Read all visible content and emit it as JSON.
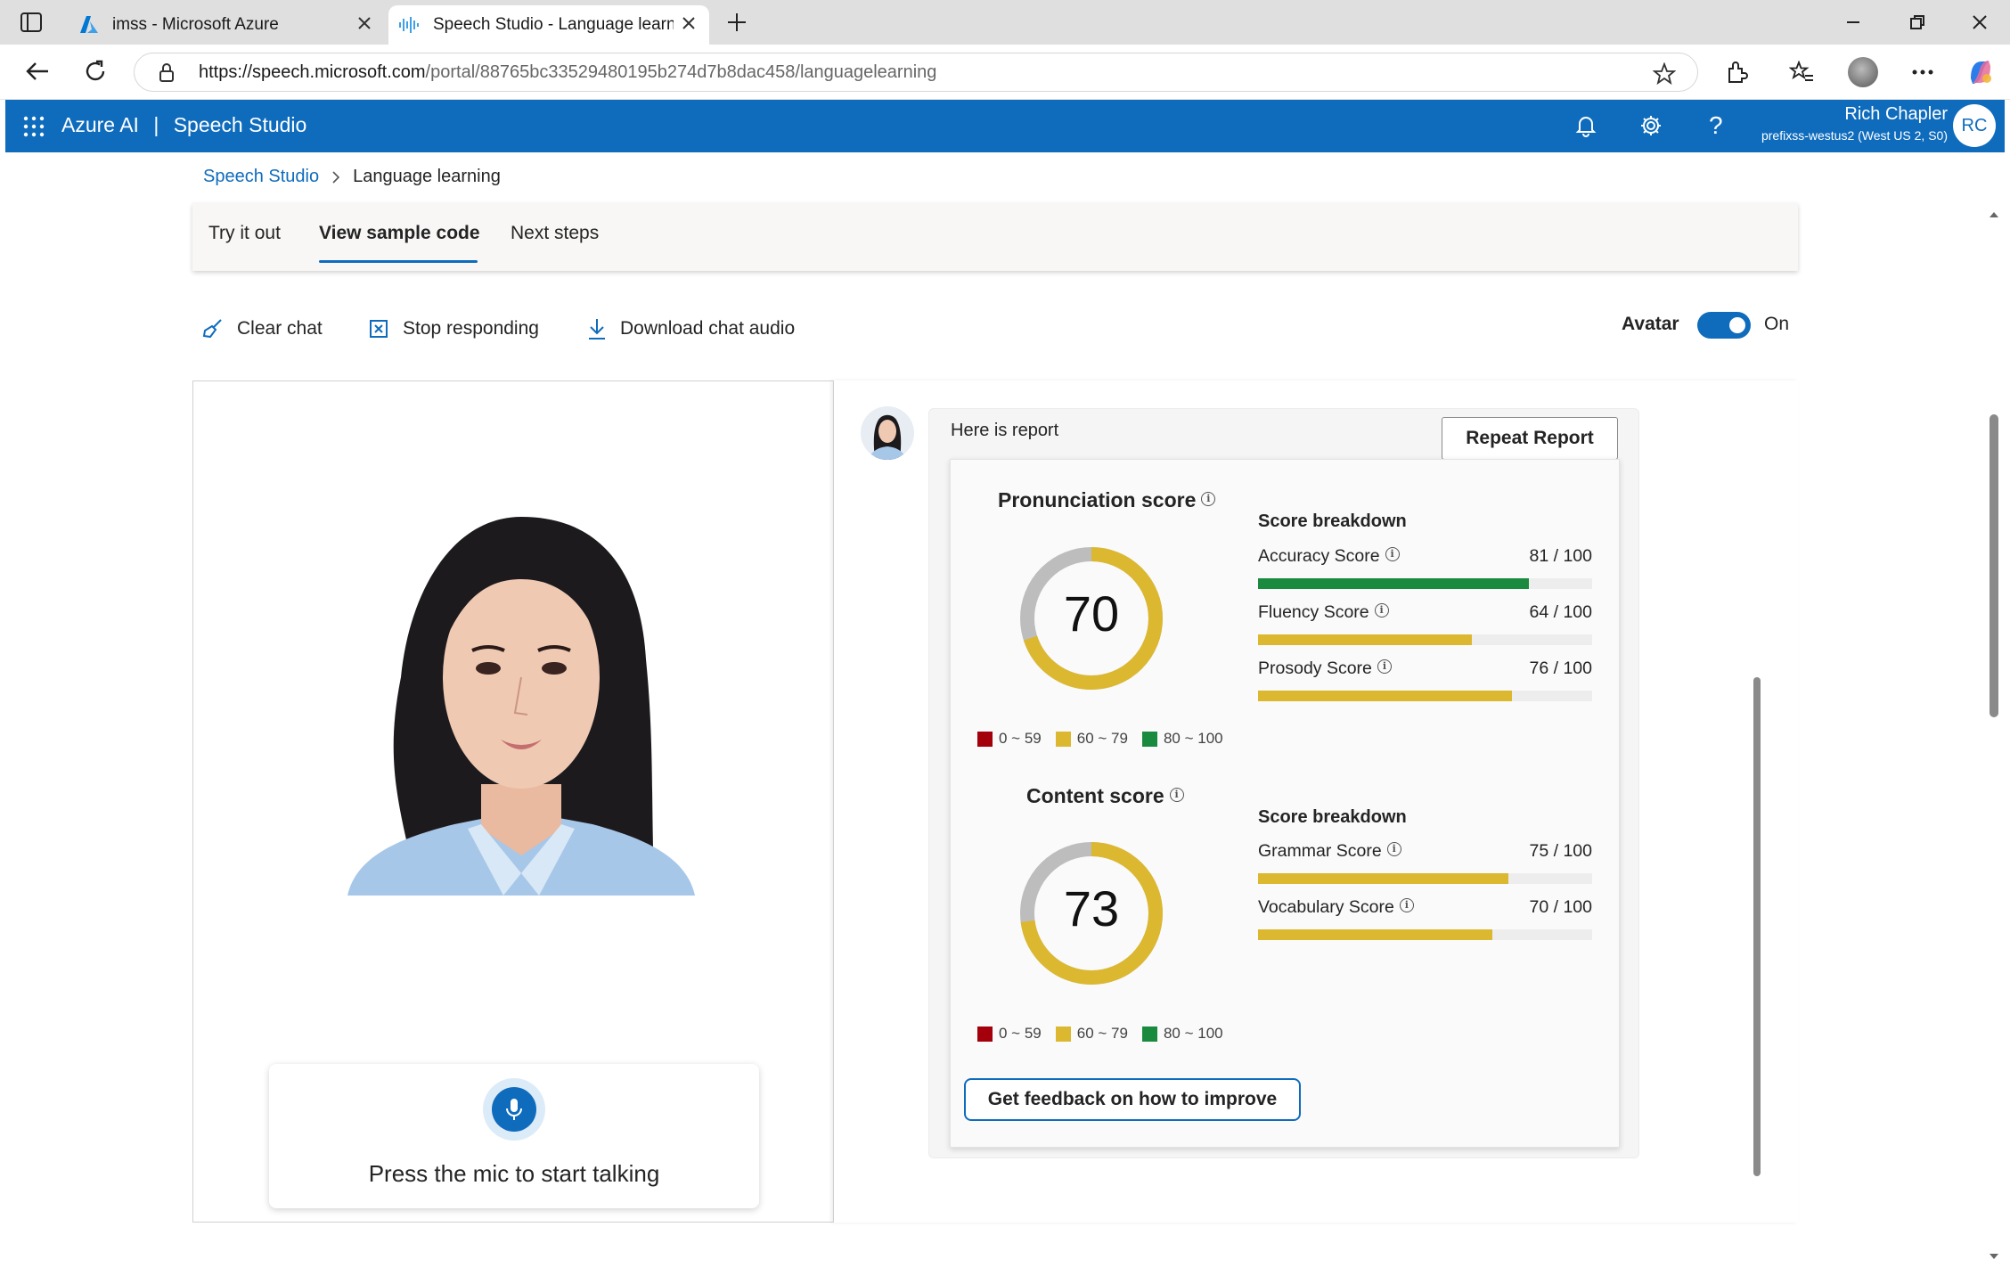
{
  "browser": {
    "tabs": [
      {
        "title": "imss - Microsoft Azure",
        "icon": "azure-logo-icon"
      },
      {
        "title": "Speech Studio - Language learnin",
        "icon": "speech-waveform-icon"
      }
    ],
    "url_host": "https://speech.microsoft.com",
    "url_path": "/portal/88765bc33529480195b274d7b8dac458/languagelearning"
  },
  "header": {
    "brand": "Azure AI",
    "separator": "|",
    "product": "Speech Studio",
    "user_name": "Rich Chapler",
    "user_sub": "prefixss-westus2 (West US 2, S0)",
    "user_initials": "RC"
  },
  "breadcrumb": {
    "root": "Speech Studio",
    "current": "Language learning"
  },
  "tabs": [
    {
      "label": "Try it out",
      "active": false
    },
    {
      "label": "View sample code",
      "active": true
    },
    {
      "label": "Next steps",
      "active": false
    }
  ],
  "toolbar": {
    "clear_chat": "Clear chat",
    "stop_responding": "Stop responding",
    "download_audio": "Download chat audio",
    "avatar_label": "Avatar",
    "avatar_state": "On"
  },
  "mic": {
    "prompt": "Press the mic to start talking"
  },
  "chat": {
    "message": "Here is report",
    "repeat_button": "Repeat Report",
    "feedback_button": "Get feedback on how to improve"
  },
  "pronunciation": {
    "title": "Pronunciation score",
    "score": "70",
    "breakdown_title": "Score breakdown",
    "items": [
      {
        "label": "Accuracy Score",
        "value": "81 / 100",
        "fraction": 0.81,
        "color": "#1a8a3e"
      },
      {
        "label": "Fluency Score",
        "value": "64 / 100",
        "fraction": 0.64,
        "color": "#dcb830"
      },
      {
        "label": "Prosody Score",
        "value": "76 / 100",
        "fraction": 0.76,
        "color": "#dcb830"
      }
    ]
  },
  "content": {
    "title": "Content score",
    "score": "73",
    "breakdown_title": "Score breakdown",
    "items": [
      {
        "label": "Grammar Score",
        "value": "75 / 100",
        "fraction": 0.75,
        "color": "#dcb830"
      },
      {
        "label": "Vocabulary Score",
        "value": "70 / 100",
        "fraction": 0.7,
        "color": "#dcb830"
      }
    ]
  },
  "legend": [
    {
      "label": "0 ~ 59",
      "color": "#a4000c"
    },
    {
      "label": "60 ~ 79",
      "color": "#dcb830"
    },
    {
      "label": "80 ~ 100",
      "color": "#1a8a3e"
    }
  ],
  "colors": {
    "accent": "#0f6cbd",
    "donut_fill": "#dcb830",
    "donut_track": "#bdbdbd"
  }
}
